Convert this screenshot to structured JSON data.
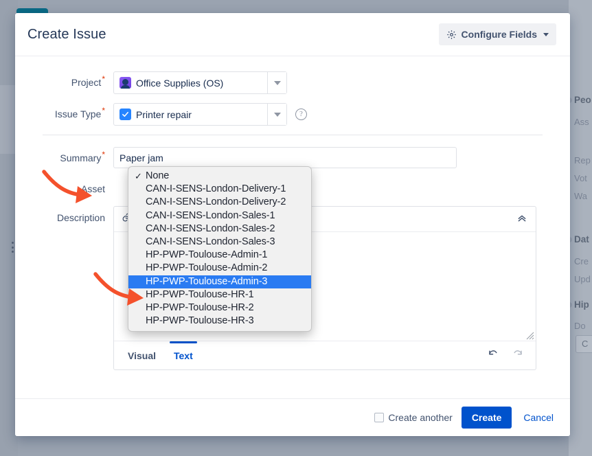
{
  "dialog": {
    "title": "Create Issue",
    "configure_fields_label": "Configure Fields",
    "gear_icon": "gear-icon",
    "configure_caret_icon": "chevron-down-icon"
  },
  "fields": {
    "project": {
      "label": "Project",
      "required_marker": "*",
      "value": "Office Supplies (OS)",
      "icon": "project-avatar-icon",
      "dropdown_icon": "chevron-down-icon"
    },
    "issue_type": {
      "label": "Issue Type",
      "required_marker": "*",
      "value": "Printer repair",
      "icon": "checkbox-checked-icon",
      "dropdown_icon": "chevron-down-icon",
      "help_icon": "question-circle-icon",
      "help_label": "?"
    },
    "summary": {
      "label": "Summary",
      "required_marker": "*",
      "value": "Paper jam",
      "placeholder": ""
    },
    "asset": {
      "label": "Asset"
    },
    "description": {
      "label": "Description",
      "value": "",
      "placeholder": ""
    }
  },
  "asset_dropdown": {
    "selected_index": 8,
    "checked_index": 0,
    "check_glyph": "✓",
    "options": [
      "None",
      "CAN-I-SENS-London-Delivery-1",
      "CAN-I-SENS-London-Delivery-2",
      "CAN-I-SENS-London-Sales-1",
      "CAN-I-SENS-London-Sales-2",
      "CAN-I-SENS-London-Sales-3",
      "HP-PWP-Toulouse-Admin-1",
      "HP-PWP-Toulouse-Admin-2",
      "HP-PWP-Toulouse-Admin-3",
      "HP-PWP-Toulouse-HR-1",
      "HP-PWP-Toulouse-HR-2",
      "HP-PWP-Toulouse-HR-3"
    ],
    "highlight_color": "#2a7bf2"
  },
  "editor": {
    "toolbar": [
      {
        "name": "link-icon",
        "has_chevron": true
      },
      {
        "name": "bullet-list-icon",
        "has_chevron": false
      },
      {
        "name": "numbered-list-icon",
        "has_chevron": false
      },
      {
        "name": "emoji-icon",
        "has_chevron": true
      },
      {
        "name": "plus-icon",
        "has_chevron": true
      }
    ],
    "collapse_icon": "chevron-up-double-icon",
    "tabs": [
      {
        "label": "Visual",
        "active": false
      },
      {
        "label": "Text",
        "active": true
      }
    ],
    "undo_icon": "undo-icon",
    "redo_icon": "redo-icon",
    "resize_handle": "resize-grip-icon"
  },
  "footer": {
    "create_another_label": "Create another",
    "create_another_checked": false,
    "create_label": "Create",
    "cancel_label": "Cancel",
    "primary_color": "#0052cc"
  },
  "right_panel": {
    "sections": [
      {
        "heading": "Peo",
        "lines": [
          "Ass",
          "",
          "Rep",
          "Vot",
          "Wa"
        ]
      },
      {
        "heading": "Dat",
        "lines": [
          "Cre",
          "Upd"
        ]
      },
      {
        "heading": "Hip",
        "lines": [
          "Do "
        ]
      }
    ],
    "button_label": "C"
  },
  "annotations": {
    "arrow_1": "red-arrow-pointing-to-asset-field",
    "arrow_2": "red-arrow-pointing-to-selected-option",
    "color": "#f4512c"
  }
}
